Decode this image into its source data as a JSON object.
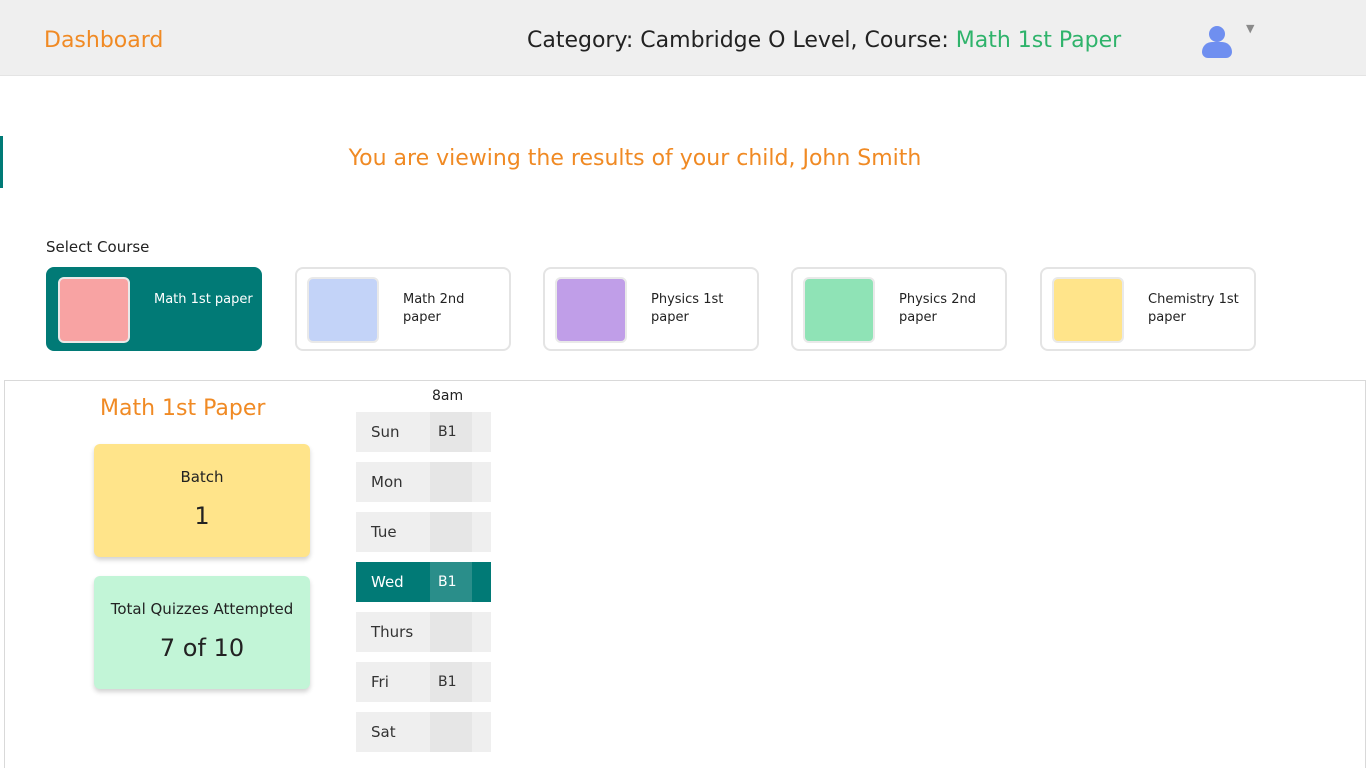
{
  "header": {
    "dashboard_label": "Dashboard",
    "category_prefix": "Category: Cambridge O Level, Course: ",
    "course_highlight": "Math 1st Paper",
    "avatar_icon": "user-icon",
    "caret_icon": "caret-down-icon",
    "caret_glyph": "▼"
  },
  "notice": "You are viewing the results of your child, John Smith",
  "select_course_label": "Select Course",
  "courses": [
    {
      "label": "Math 1st paper",
      "color": "#f8a3a3",
      "selected": true
    },
    {
      "label": "Math 2nd paper",
      "color": "#c3d3f8",
      "selected": false
    },
    {
      "label": "Physics 1st paper",
      "color": "#c09ee8",
      "selected": false
    },
    {
      "label": "Physics 2nd paper",
      "color": "#8fe3b6",
      "selected": false
    },
    {
      "label": "Chemistry 1st paper",
      "color": "#ffe48a",
      "selected": false
    }
  ],
  "summary": {
    "course_title": "Math 1st Paper",
    "batch_label": "Batch",
    "batch_value": "1",
    "quiz_label": "Total Quizzes Attempted",
    "quiz_value": "7 of 10"
  },
  "schedule": {
    "time_header": "8am",
    "days": [
      {
        "day": "Sun",
        "slot": "B1",
        "active": false
      },
      {
        "day": "Mon",
        "slot": "",
        "active": false
      },
      {
        "day": "Tue",
        "slot": "",
        "active": false
      },
      {
        "day": "Wed",
        "slot": "B1",
        "active": true
      },
      {
        "day": "Thurs",
        "slot": "",
        "active": false
      },
      {
        "day": "Fri",
        "slot": "B1",
        "active": false
      },
      {
        "day": "Sat",
        "slot": "",
        "active": false
      }
    ]
  },
  "colors": {
    "accent_orange": "#f08a24",
    "accent_green": "#2fb36b",
    "teal": "#017a76"
  }
}
